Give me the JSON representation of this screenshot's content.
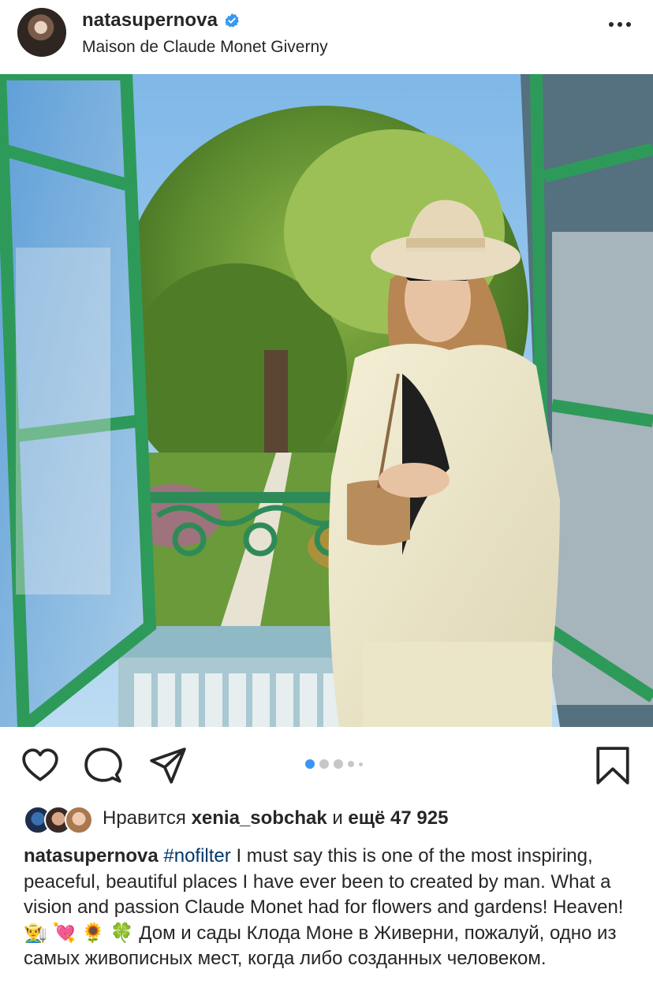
{
  "post": {
    "username": "natasupernova",
    "location": "Maison de Claude Monet Giverny",
    "verified": true
  },
  "carousel": {
    "current_index": 1,
    "total": 5
  },
  "likes": {
    "prefix": "Нравится",
    "liker": "xenia_sobchak",
    "conj": "и",
    "rest": "ещё 47 925"
  },
  "caption": {
    "username": "natasupernova",
    "hashtag": "#nofilter",
    "text": "I must say this is one of the most inspiring, peaceful, beautiful places I have ever been to created by man. What a vision and passion Claude Monet had for flowers and gardens! Heaven! 👨‍🌾 💘 🌻 🍀 Дом и сады Клода Моне в Живерни, пожалуй, одно из самых живописных мест, когда либо созданных человеком."
  },
  "colors": {
    "accent_blue": "#3897f0",
    "text": "#262626",
    "hashtag": "#00376b",
    "window_green": "#2e8b57"
  },
  "icons": {
    "like": "heart-icon",
    "comment": "comment-icon",
    "share": "paper-plane-icon",
    "save": "bookmark-icon",
    "more": "more-dots-icon",
    "verified": "verified-badge-icon"
  }
}
